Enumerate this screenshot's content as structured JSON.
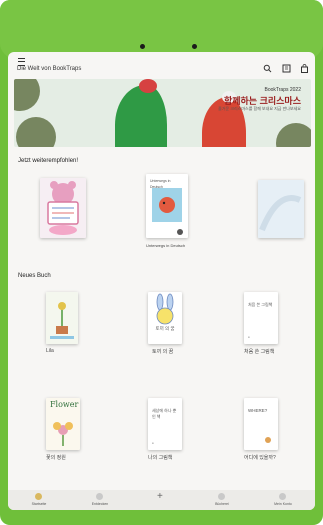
{
  "app": {
    "title": "Die Welt von BookTraps"
  },
  "toolbar": {
    "search_icon": "search-icon",
    "library_icon": "library-icon",
    "bag_icon": "bag-icon"
  },
  "banner": {
    "subtitle": "BookTraps 2022",
    "title": "함께하는 크리스마스",
    "description": "즐거운 크리스마스를 함께 보내요 지금 만나보세요"
  },
  "recommended": {
    "heading": "Jetzt weiterempfohlen!",
    "books": [
      {
        "title": "",
        "label": ""
      },
      {
        "title": "Unterwegs in Deutsch",
        "label": "Unterwegs in Deutsch"
      },
      {
        "title": "",
        "label": ""
      }
    ]
  },
  "new_books": {
    "heading": "Neues Buch",
    "books": [
      {
        "title": "",
        "label": "Lila"
      },
      {
        "title": "토끼 의 꿈",
        "label": "토끼 의 꿈"
      },
      {
        "title": "처음 쓴 그림책",
        "label": "처음 쓴 그림책"
      },
      {
        "title": "Flower",
        "label": "꽃의 정원"
      },
      {
        "title": "세상에 하나 뿐인 책",
        "label": "나의 그림책"
      },
      {
        "title": "WHERE?",
        "label": "어디에 있을까?"
      }
    ]
  },
  "nav": [
    {
      "label": "Startseite"
    },
    {
      "label": "Entdecken"
    },
    {
      "label": ""
    },
    {
      "label": "Bücherei"
    },
    {
      "label": "Mein Konto"
    }
  ],
  "colors": {
    "bezel": "#79c544",
    "screen": "#f7f6f4",
    "banner_title": "#9a1d1d"
  }
}
